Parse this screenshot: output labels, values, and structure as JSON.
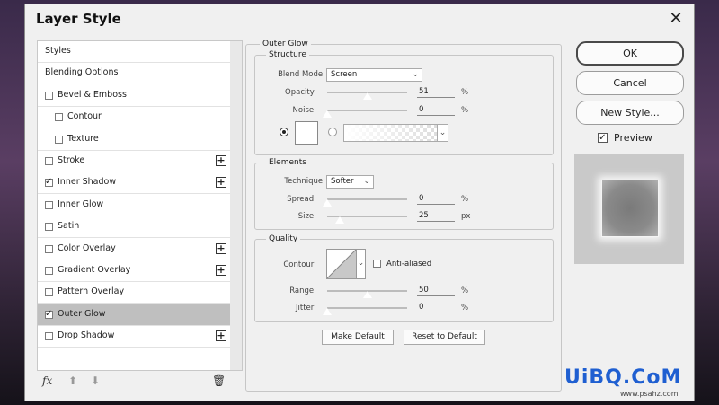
{
  "dialog": {
    "title": "Layer Style"
  },
  "styles_list": [
    {
      "label": "Styles",
      "checkbox": false,
      "checked": false,
      "plus": false,
      "indent": 0,
      "selected": false
    },
    {
      "label": "Blending Options",
      "checkbox": false,
      "checked": false,
      "plus": false,
      "indent": 0,
      "selected": false
    },
    {
      "label": "Bevel & Emboss",
      "checkbox": true,
      "checked": false,
      "plus": false,
      "indent": 0,
      "selected": false
    },
    {
      "label": "Contour",
      "checkbox": true,
      "checked": false,
      "plus": false,
      "indent": 1,
      "selected": false
    },
    {
      "label": "Texture",
      "checkbox": true,
      "checked": false,
      "plus": false,
      "indent": 1,
      "selected": false
    },
    {
      "label": "Stroke",
      "checkbox": true,
      "checked": false,
      "plus": true,
      "indent": 0,
      "selected": false
    },
    {
      "label": "Inner Shadow",
      "checkbox": true,
      "checked": true,
      "plus": true,
      "indent": 0,
      "selected": false
    },
    {
      "label": "Inner Glow",
      "checkbox": true,
      "checked": false,
      "plus": false,
      "indent": 0,
      "selected": false
    },
    {
      "label": "Satin",
      "checkbox": true,
      "checked": false,
      "plus": false,
      "indent": 0,
      "selected": false
    },
    {
      "label": "Color Overlay",
      "checkbox": true,
      "checked": false,
      "plus": true,
      "indent": 0,
      "selected": false
    },
    {
      "label": "Gradient Overlay",
      "checkbox": true,
      "checked": false,
      "plus": true,
      "indent": 0,
      "selected": false
    },
    {
      "label": "Pattern Overlay",
      "checkbox": true,
      "checked": false,
      "plus": false,
      "indent": 0,
      "selected": false
    },
    {
      "label": "Outer Glow",
      "checkbox": true,
      "checked": true,
      "plus": false,
      "indent": 0,
      "selected": true
    },
    {
      "label": "Drop Shadow",
      "checkbox": true,
      "checked": false,
      "plus": true,
      "indent": 0,
      "selected": false
    }
  ],
  "bottom_icons": [
    "fx-icon",
    "arrow-up-icon",
    "arrow-down-icon",
    "trash-icon"
  ],
  "fx_label": "fx",
  "outer_glow": {
    "title": "Outer Glow",
    "structure": {
      "title": "Structure",
      "blend_mode_label": "Blend Mode:",
      "blend_mode": "Screen",
      "opacity_label": "Opacity:",
      "opacity": "51",
      "noise_label": "Noise:",
      "noise": "0",
      "percent": "%"
    },
    "elements": {
      "title": "Elements",
      "technique_label": "Technique:",
      "technique": "Softer",
      "spread_label": "Spread:",
      "spread": "0",
      "size_label": "Size:",
      "size": "25",
      "px": "px",
      "percent": "%"
    },
    "quality": {
      "title": "Quality",
      "contour_label": "Contour:",
      "anti_aliased_label": "Anti-aliased",
      "range_label": "Range:",
      "range": "50",
      "jitter_label": "Jitter:",
      "jitter": "0",
      "percent": "%"
    },
    "make_default": "Make Default",
    "reset_default": "Reset to Default"
  },
  "buttons": {
    "ok": "OK",
    "cancel": "Cancel",
    "new_style": "New Style..."
  },
  "preview": {
    "label": "Preview",
    "checked": true
  },
  "watermark": {
    "main": "UiBQ.CoM",
    "sub": "www.psahz.com"
  }
}
